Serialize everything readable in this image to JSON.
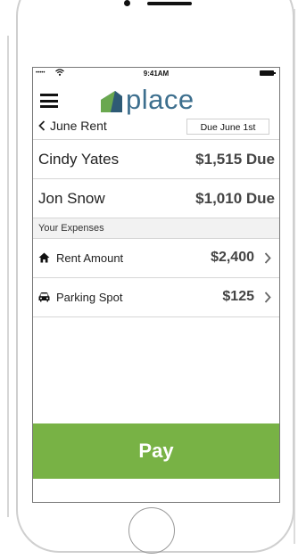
{
  "status_bar": {
    "signal": "•••••",
    "time": "9:41AM"
  },
  "header": {
    "logo_text": "place",
    "menu_icon": "hamburger-menu-icon"
  },
  "rent_bar": {
    "back_label": "June Rent",
    "due_label": "Due June 1st"
  },
  "roommates": [
    {
      "name": "Cindy Yates",
      "due": "$1,515 Due"
    },
    {
      "name": "Jon Snow",
      "due": "$1,010 Due"
    }
  ],
  "expenses_section": {
    "title": "Your Expenses",
    "items": [
      {
        "label": "Rent Amount",
        "amount": "$2,400",
        "icon": "home-icon"
      },
      {
        "label": "Parking Spot",
        "amount": "$125",
        "icon": "car-icon"
      }
    ]
  },
  "pay_button": {
    "label": "Pay"
  },
  "colors": {
    "accent_green": "#78b245",
    "logo_blue": "#3d6f8e",
    "logo_green": "#6aa84f"
  }
}
